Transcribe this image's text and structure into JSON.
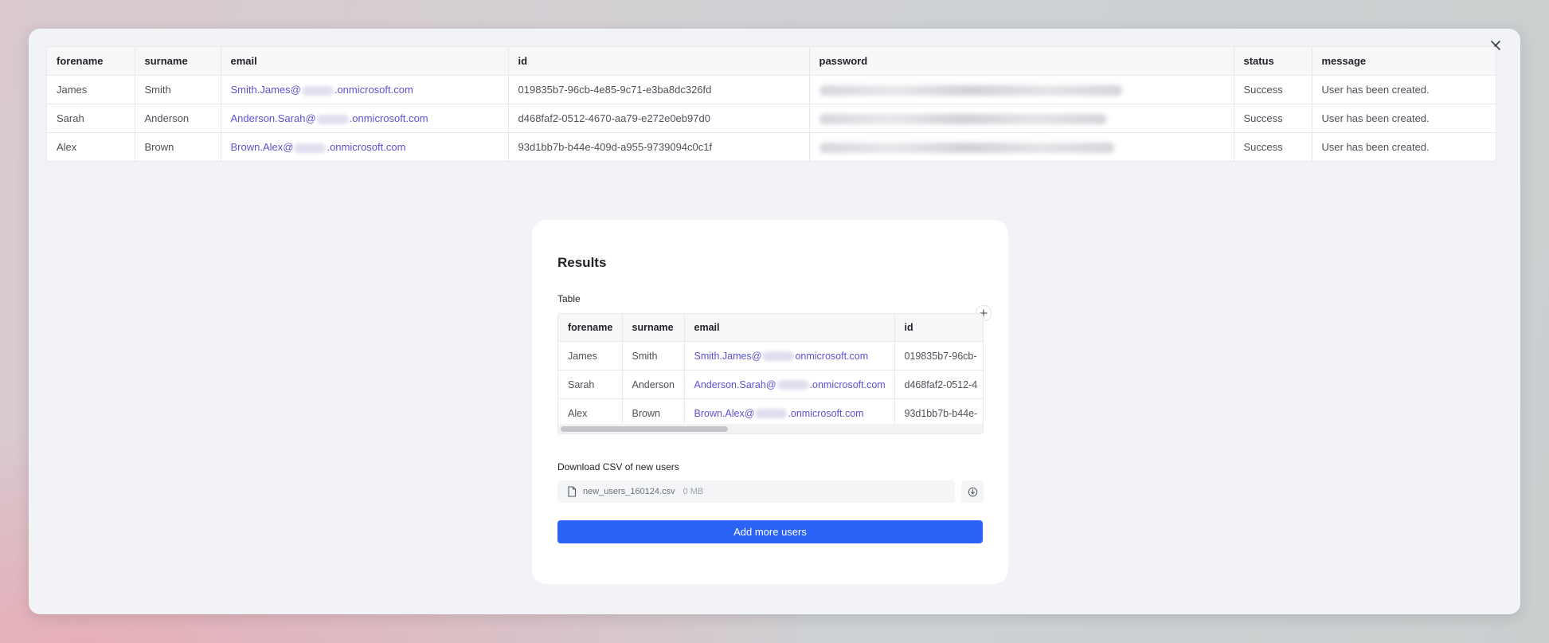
{
  "columns": [
    "forename",
    "surname",
    "email",
    "id",
    "password",
    "status",
    "message"
  ],
  "rows": [
    {
      "forename": "James",
      "surname": "Smith",
      "email_prefix": "Smith.James@",
      "email_suffix": ".onmicrosoft.com",
      "id": "019835b7-96cb-4e85-9c71-e3ba8dc326fd",
      "status": "Success",
      "message": "User has been created."
    },
    {
      "forename": "Sarah",
      "surname": "Anderson",
      "email_prefix": "Anderson.Sarah@",
      "email_suffix": ".onmicrosoft.com",
      "id": "d468faf2-0512-4670-aa79-e272e0eb97d0",
      "status": "Success",
      "message": "User has been created."
    },
    {
      "forename": "Alex",
      "surname": "Brown",
      "email_prefix": "Brown.Alex@",
      "email_suffix": ".onmicrosoft.com",
      "id": "93d1bb7b-b44e-409d-a955-9739094c0c1f",
      "status": "Success",
      "message": "User has been created."
    }
  ],
  "results": {
    "title": "Results",
    "table_label": "Table",
    "mini_columns": [
      "forename",
      "surname",
      "email",
      "id"
    ],
    "mini_rows": [
      {
        "forename": "James",
        "surname": "Smith",
        "email_prefix": "Smith.James@",
        "email_suffix": "onmicrosoft.com",
        "id_partial": "019835b7-96cb-"
      },
      {
        "forename": "Sarah",
        "surname": "Anderson",
        "email_prefix": "Anderson.Sarah@",
        "email_suffix": ".onmicrosoft.com",
        "id_partial": "d468faf2-0512-4"
      },
      {
        "forename": "Alex",
        "surname": "Brown",
        "email_prefix": "Brown.Alex@",
        "email_suffix": ".onmicrosoft.com",
        "id_partial": "93d1bb7b-b44e-"
      }
    ],
    "csv_label": "Download CSV of new users",
    "file_name": "new_users_160124.csv",
    "file_size": "0 MB",
    "add_more_label": "Add more users"
  },
  "icons": {
    "close": "close-icon",
    "plus": "plus-icon",
    "file": "file-icon",
    "download": "download-icon"
  },
  "colors": {
    "accent": "#2b63f6",
    "link": "#5b52d6"
  }
}
